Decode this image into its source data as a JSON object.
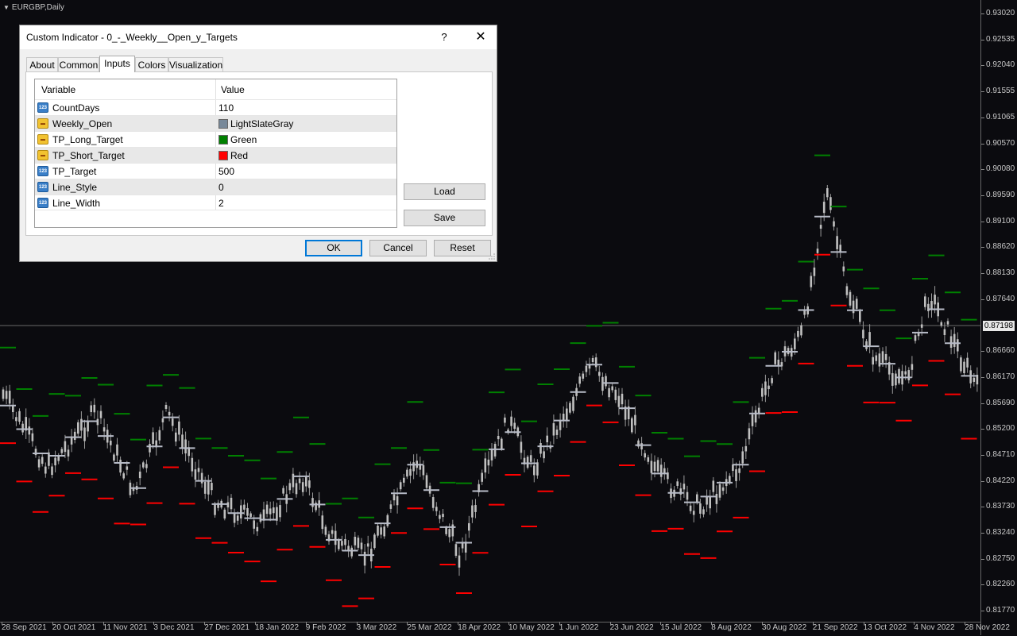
{
  "chart": {
    "symbol_title": "EURGBP,Daily",
    "current_price": "0.87198",
    "price_labels": [
      "0.93020",
      "0.92535",
      "0.92040",
      "0.91555",
      "0.91065",
      "0.90570",
      "0.90080",
      "0.89590",
      "0.89100",
      "0.88620",
      "0.88130",
      "0.87640",
      "0.86660",
      "0.86170",
      "0.85690",
      "0.85200",
      "0.84710",
      "0.84220",
      "0.83730",
      "0.83240",
      "0.82750",
      "0.82260",
      "0.81770"
    ],
    "time_labels": [
      "28 Sep 2021",
      "20 Oct 2021",
      "11 Nov 2021",
      "3 Dec 2021",
      "27 Dec 2021",
      "18 Jan 2022",
      "9 Feb 2022",
      "3 Mar 2022",
      "25 Mar 2022",
      "18 Apr 2022",
      "10 May 2022",
      "1 Jun 2022",
      "23 Jun 2022",
      "15 Jul 2022",
      "8 Aug 2022",
      "30 Aug 2022",
      "21 Sep 2022",
      "13 Oct 2022",
      "4 Nov 2022",
      "28 Nov 2022"
    ],
    "colors": {
      "background": "#0b0b0f",
      "candle": "#c0c0c0",
      "weekly_open": "#b8bcc8",
      "long_target": "#008000",
      "short_target": "#ff0000"
    }
  },
  "dialog": {
    "title": "Custom Indicator - 0_-_Weekly__Open_y_Targets",
    "help_label": "?",
    "close_label": "✕",
    "tabs": [
      "About",
      "Common",
      "Inputs",
      "Colors",
      "Visualization"
    ],
    "active_tab": "Inputs",
    "columns": {
      "variable": "Variable",
      "value": "Value"
    },
    "rows": [
      {
        "variable": "CountDays",
        "value": "110",
        "icon": "int-param-icon"
      },
      {
        "variable": "Weekly_Open",
        "value": "LightSlateGray",
        "icon": "color-param-icon",
        "color": "#778899"
      },
      {
        "variable": "TP_Long_Target",
        "value": "Green",
        "icon": "color-param-icon",
        "color": "#008000"
      },
      {
        "variable": "TP_Short_Target",
        "value": "Red",
        "icon": "color-param-icon",
        "color": "#ff0000"
      },
      {
        "variable": "TP_Target",
        "value": "500",
        "icon": "int-param-icon"
      },
      {
        "variable": "Line_Style",
        "value": "0",
        "icon": "int-param-icon"
      },
      {
        "variable": "Line_Width",
        "value": "2",
        "icon": "int-param-icon"
      }
    ],
    "load_label": "Load",
    "save_label": "Save",
    "ok_label": "OK",
    "cancel_label": "Cancel",
    "reset_label": "Reset"
  }
}
